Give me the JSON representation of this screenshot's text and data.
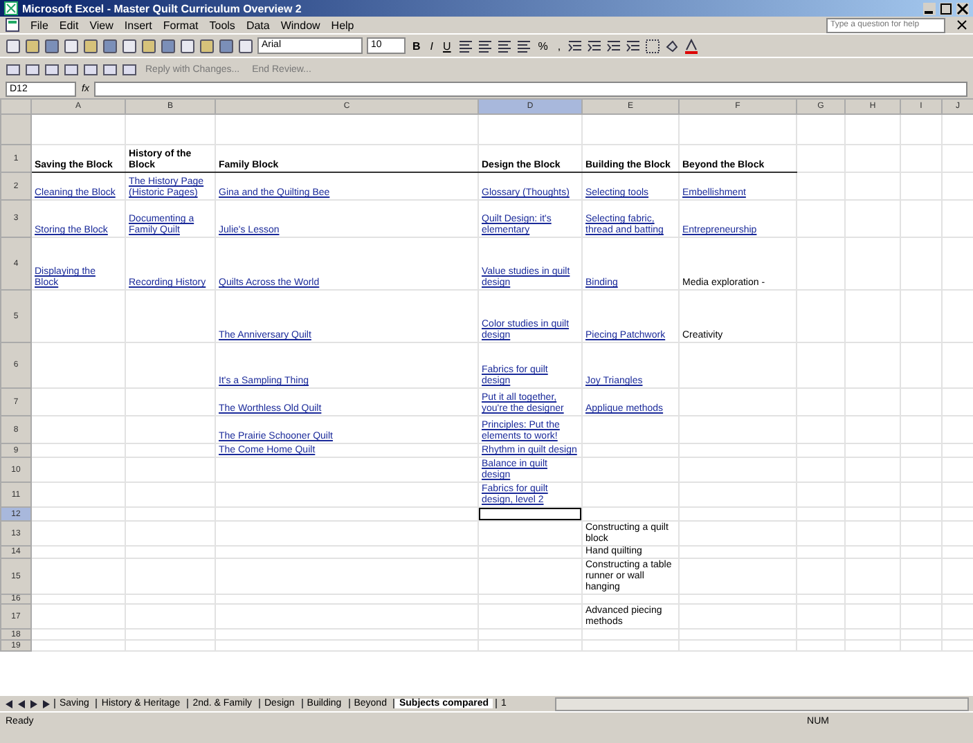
{
  "window": {
    "title": "Microsoft Excel - Master Quilt Curriculum Overview 2"
  },
  "menu": [
    "File",
    "Edit",
    "View",
    "Insert",
    "Format",
    "Tools",
    "Data",
    "Window",
    "Help"
  ],
  "help_search": {
    "placeholder": "Type a question for help"
  },
  "toolbar": {
    "font": "Arial",
    "size": "10",
    "format_buttons": [
      "B",
      "I",
      "U"
    ],
    "number_buttons": [
      "%",
      ","
    ]
  },
  "review_toolbar": [
    "Reply with Changes...",
    "End Review..."
  ],
  "formula_bar": {
    "name_box": "D12",
    "fx": "fx"
  },
  "columns": [
    {
      "label": "A",
      "selected": false
    },
    {
      "label": "B",
      "selected": false
    },
    {
      "label": "C",
      "selected": false
    },
    {
      "label": "D",
      "selected": true
    },
    {
      "label": "E",
      "selected": false
    },
    {
      "label": "F",
      "selected": false
    },
    {
      "label": "G",
      "selected": false
    },
    {
      "label": "H",
      "selected": false
    },
    {
      "label": "I",
      "selected": false
    },
    {
      "label": "J",
      "selected": false
    }
  ],
  "rows": [
    {
      "selected": false,
      "cells": []
    },
    {
      "number": "1",
      "selected": false,
      "cells": [
        {
          "kind": "header",
          "text": "Saving the Block"
        },
        {
          "kind": "header",
          "text": "History of the Block"
        },
        {
          "kind": "header",
          "text": "Family Block"
        },
        {
          "kind": "header",
          "text": "Design the Block"
        },
        {
          "kind": "header",
          "text": "Building the Block"
        },
        {
          "kind": "header",
          "text": "Beyond the Block"
        }
      ]
    },
    {
      "number": "2",
      "selected": false,
      "cells": [
        {
          "kind": "link",
          "text": "Cleaning the Block"
        },
        {
          "kind": "link",
          "text": "The History Page (Historic Pages)"
        },
        {
          "kind": "link",
          "text": "Gina and the Quilting Bee"
        },
        {
          "kind": "link",
          "text": "Glossary (Thoughts)"
        },
        {
          "kind": "link",
          "text": "Selecting tools"
        },
        {
          "kind": "link",
          "text": "Embellishment"
        }
      ]
    },
    {
      "number": "3",
      "selected": false,
      "cells": [
        {
          "kind": "link",
          "text": "Storing the Block"
        },
        {
          "kind": "link",
          "text": "Documenting a Family Quilt"
        },
        {
          "kind": "link",
          "text": "Julie's Lesson"
        },
        {
          "kind": "link",
          "text": "Quilt Design: it's elementary"
        },
        {
          "kind": "link",
          "text": "Selecting fabric, thread and batting"
        },
        {
          "kind": "link",
          "text": "Entrepreneurship"
        }
      ]
    },
    {
      "number": "4",
      "selected": false,
      "cells": [
        {
          "kind": "link",
          "text": "Displaying the Block"
        },
        {
          "kind": "link",
          "text": "Recording History"
        },
        {
          "kind": "link",
          "text": "Quilts Across the World"
        },
        {
          "kind": "link",
          "text": "Value studies in quilt design"
        },
        {
          "kind": "link",
          "text": "Binding"
        },
        {
          "kind": "text",
          "text": "Media exploration -"
        }
      ]
    },
    {
      "number": "5",
      "selected": false,
      "cells": [
        {
          "kind": "empty"
        },
        {
          "kind": "empty"
        },
        {
          "kind": "link",
          "text": "The Anniversary Quilt"
        },
        {
          "kind": "link",
          "text": "Color studies in quilt design"
        },
        {
          "kind": "link",
          "text": "Piecing Patchwork"
        },
        {
          "kind": "text",
          "text": "Creativity"
        }
      ]
    },
    {
      "number": "6",
      "selected": false,
      "cells": [
        {
          "kind": "empty"
        },
        {
          "kind": "empty"
        },
        {
          "kind": "link",
          "text": "It's a Sampling Thing"
        },
        {
          "kind": "link",
          "text": "Fabrics for quilt design"
        },
        {
          "kind": "link",
          "text": "Joy Triangles"
        }
      ]
    },
    {
      "number": "7",
      "selected": false,
      "cells": [
        {
          "kind": "empty"
        },
        {
          "kind": "empty"
        },
        {
          "kind": "link",
          "text": "The Worthless Old Quilt"
        },
        {
          "kind": "link",
          "text": "Put it all together, you're the designer"
        },
        {
          "kind": "link",
          "text": "Applique methods"
        }
      ]
    },
    {
      "number": "8",
      "selected": false,
      "cells": [
        {
          "kind": "empty"
        },
        {
          "kind": "empty"
        },
        {
          "kind": "link",
          "text": "The Prairie Schooner Quilt"
        },
        {
          "kind": "link",
          "text": "Principles: Put the elements to work!"
        }
      ]
    },
    {
      "number": "9",
      "selected": false,
      "cells": [
        {
          "kind": "empty"
        },
        {
          "kind": "empty"
        },
        {
          "kind": "link",
          "text": "The Come Home Quilt"
        },
        {
          "kind": "link",
          "text": "Rhythm in quilt design"
        }
      ]
    },
    {
      "number": "10",
      "selected": false,
      "cells": [
        {
          "kind": "empty"
        },
        {
          "kind": "empty"
        },
        {
          "kind": "empty"
        },
        {
          "kind": "link",
          "text": "Balance in quilt design"
        }
      ]
    },
    {
      "number": "11",
      "selected": false,
      "cells": [
        {
          "kind": "empty"
        },
        {
          "kind": "empty"
        },
        {
          "kind": "empty"
        },
        {
          "kind": "link",
          "text": "Fabrics for quilt design, level 2"
        }
      ]
    },
    {
      "number": "12",
      "selected": true,
      "cells": [
        {
          "kind": "empty"
        },
        {
          "kind": "empty"
        },
        {
          "kind": "empty"
        },
        {
          "kind": "empty",
          "selected": true
        }
      ]
    },
    {
      "number": "13",
      "selected": false,
      "cells": [
        {
          "kind": "empty"
        },
        {
          "kind": "empty"
        },
        {
          "kind": "empty"
        },
        {
          "kind": "empty"
        },
        {
          "kind": "text",
          "text": "Constructing a quilt block"
        }
      ]
    },
    {
      "number": "14",
      "selected": false,
      "cells": [
        {
          "kind": "empty"
        },
        {
          "kind": "empty"
        },
        {
          "kind": "empty"
        },
        {
          "kind": "empty"
        },
        {
          "kind": "text",
          "text": "Hand quilting"
        }
      ]
    },
    {
      "number": "15",
      "selected": false,
      "cells": [
        {
          "kind": "empty"
        },
        {
          "kind": "empty"
        },
        {
          "kind": "empty"
        },
        {
          "kind": "empty"
        },
        {
          "kind": "text",
          "text": "Constructing a table runner or wall hanging"
        }
      ]
    },
    {
      "number": "16",
      "selected": false,
      "cells": []
    },
    {
      "number": "17",
      "selected": false,
      "cells": [
        {
          "kind": "empty"
        },
        {
          "kind": "empty"
        },
        {
          "kind": "empty"
        },
        {
          "kind": "empty"
        },
        {
          "kind": "text",
          "text": "Advanced piecing methods"
        }
      ]
    },
    {
      "number": "18",
      "selected": false,
      "cells": []
    },
    {
      "number": "19",
      "selected": false,
      "cells": []
    }
  ],
  "sheet_tabs": [
    {
      "label": "Saving",
      "selected": false
    },
    {
      "label": "History & Heritage",
      "selected": false
    },
    {
      "label": "2nd. & Family",
      "selected": false
    },
    {
      "label": "Design",
      "selected": false
    },
    {
      "label": "Building",
      "selected": false
    },
    {
      "label": "Beyond",
      "selected": false
    },
    {
      "label": "Subjects compared",
      "selected": true
    },
    {
      "label": "1",
      "selected": false
    }
  ],
  "status_bar": {
    "left": "Ready",
    "right": "NUM"
  }
}
